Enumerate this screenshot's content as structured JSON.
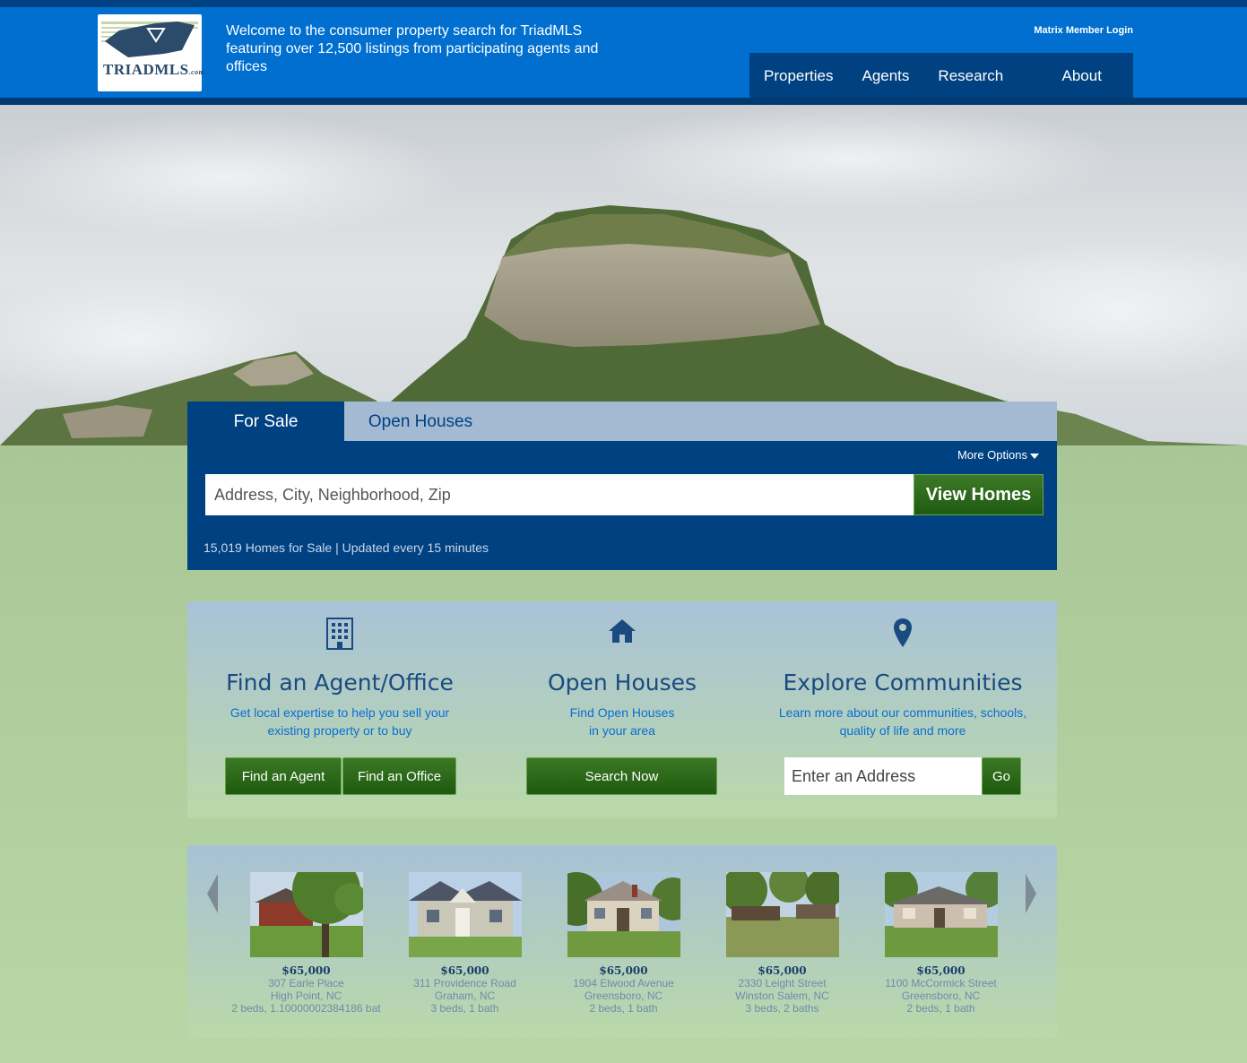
{
  "header": {
    "logo_text": "TRIADMLS",
    "logo_suffix": ".com",
    "welcome": "Welcome to the consumer property search for TriadMLS featuring over 12,500 listings from participating agents and offices",
    "member_login": "Matrix Member Login",
    "nav": [
      "Properties",
      "Agents",
      "Research Tools",
      "About Us"
    ]
  },
  "search": {
    "tabs": [
      "For Sale",
      "Open Houses"
    ],
    "more_options": "More Options",
    "placeholder": "Address, City, Neighborhood, Zip",
    "button": "View Homes",
    "status": "15,019 Homes for Sale | Updated every 15 minutes"
  },
  "features": [
    {
      "icon": "building-icon",
      "title": "Find an Agent/Office",
      "desc_lines": [
        "Get local expertise to help you sell your",
        "existing property or to buy"
      ],
      "buttons": [
        "Find an Agent",
        "Find an Office"
      ]
    },
    {
      "icon": "home-icon",
      "title": "Open Houses",
      "desc_lines": [
        "Find Open Houses",
        "in your area"
      ],
      "buttons": [
        "Search Now"
      ]
    },
    {
      "icon": "map-marker-icon",
      "title": "Explore Communities",
      "desc_lines": [
        "Learn more about our communities, schools,",
        "quality of life and more"
      ],
      "placeholder": "Enter an Address",
      "buttons": [
        "Go"
      ]
    }
  ],
  "listings": [
    {
      "price": "$65,000",
      "address": "307 Earle Place",
      "city": "High Point, NC",
      "details": "2 beds, 1.10000002384186 bat"
    },
    {
      "price": "$65,000",
      "address": "311 Providence Road",
      "city": "Graham, NC",
      "details": "3 beds, 1 bath"
    },
    {
      "price": "$65,000",
      "address": "1904 Elwood Avenue",
      "city": "Greensboro, NC",
      "details": "2 beds, 1 bath"
    },
    {
      "price": "$65,000",
      "address": "2330 Leight Street",
      "city": "Winston Salem, NC",
      "details": "3 beds, 2 baths"
    },
    {
      "price": "$65,000",
      "address": "1100 McCormick Street",
      "city": "Greensboro, NC",
      "details": "2 beds, 1 bath"
    }
  ],
  "colors": {
    "brand_blue": "#006fcf",
    "navy": "#004182",
    "green_button": "#2c6a1a"
  }
}
